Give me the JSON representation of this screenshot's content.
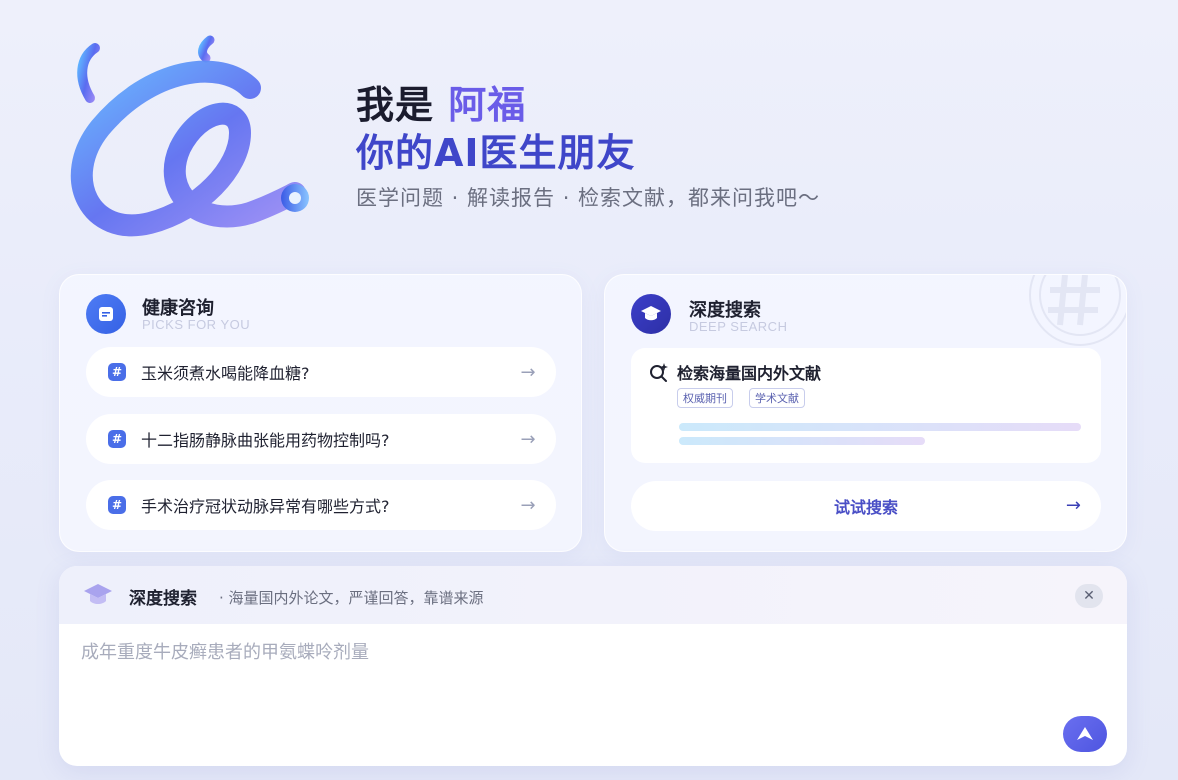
{
  "hero": {
    "title_prefix": "我是",
    "title_accent": "阿福",
    "title_line2": "你的AI医生朋友",
    "subtitle": "医学问题 · 解读报告 · 检索文献，都来问我吧～"
  },
  "health_card": {
    "title": "健康咨询",
    "subtitle": "PICKS FOR YOU",
    "icon": "document-icon",
    "questions": [
      {
        "hash": "#",
        "text": "玉米须煮水喝能降血糖?"
      },
      {
        "hash": "#",
        "text": "十二指肠静脉曲张能用药物控制吗?"
      },
      {
        "hash": "#",
        "text": "手术治疗冠状动脉异常有哪些方式?"
      }
    ]
  },
  "deep_card": {
    "title": "深度搜索",
    "subtitle": "DEEP SEARCH",
    "icon": "graduation-cap-icon",
    "search_title": "检索海量国内外文献",
    "tags": [
      "权威期刊",
      "学术文献"
    ],
    "try_label": "试试搜索"
  },
  "input_panel": {
    "mode_title": "深度搜索",
    "mode_sub": "· 海量国内外论文，严谨回答，靠谱来源",
    "placeholder": "成年重度牛皮癣患者的甲氨蝶呤剂量",
    "close_symbol": "✕"
  },
  "colors": {
    "accent": "#6a5ce8",
    "primary": "#3f46c9",
    "brand_blue": "#4a6ee8"
  }
}
